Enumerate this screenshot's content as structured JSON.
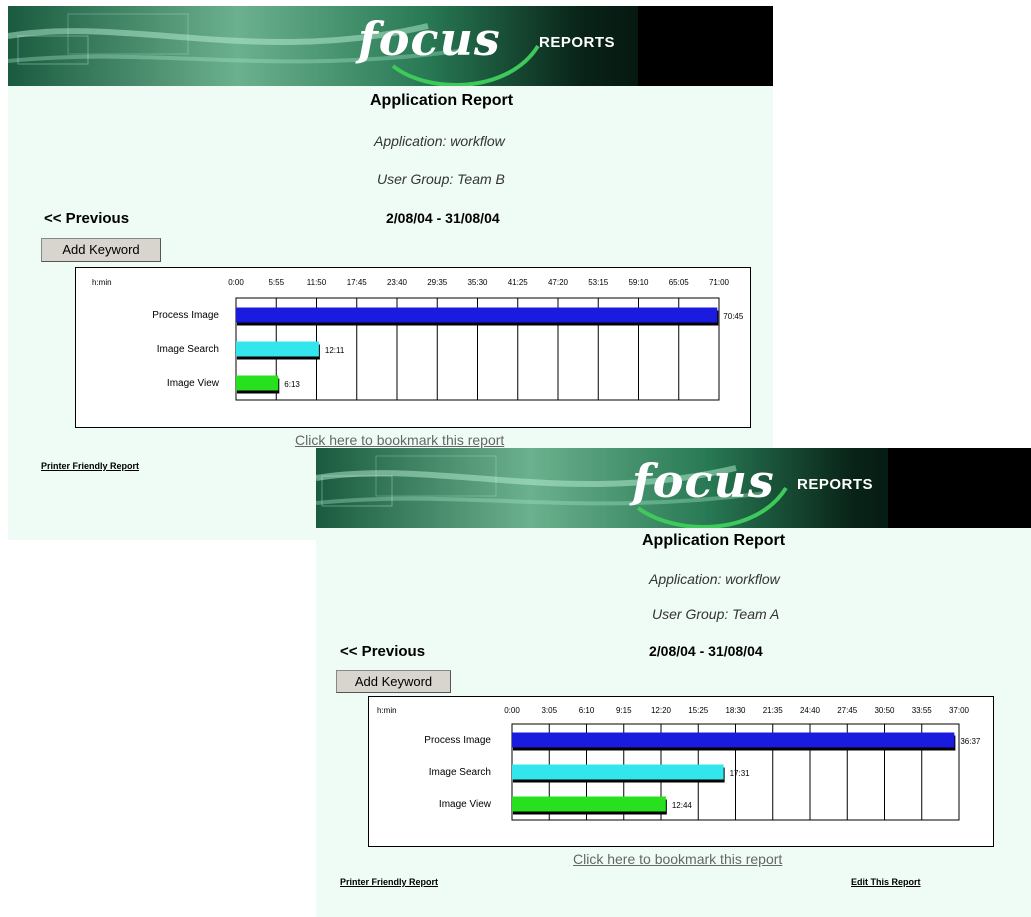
{
  "colors": {
    "background": "#effcf6",
    "bar_process": "#1b1be0",
    "bar_search": "#33e6ee",
    "bar_view": "#27e11f",
    "banner": "#000000"
  },
  "reports": [
    {
      "logo": "focus",
      "logo_sub": "REPORTS",
      "title": "Application Report",
      "application": "Application: workflow",
      "user_group": "User Group: Team B",
      "date_range": "2/08/04 - 31/08/04",
      "previous_label": "<< Previous",
      "add_keyword_label": "Add Keyword",
      "bookmark_label": "Click here to bookmark this report",
      "printer_friendly_label": "Printer Friendly Report",
      "chart_data": {
        "type": "bar",
        "orientation": "horizontal",
        "unit_label": "h:min",
        "x_ticks": [
          "0:00",
          "5:55",
          "11:50",
          "17:45",
          "23:40",
          "29:35",
          "35:30",
          "41:25",
          "47:20",
          "53:15",
          "59:10",
          "65:05",
          "71:00"
        ],
        "xlim_minutes": [
          0,
          4260
        ],
        "categories": [
          "Process Image",
          "Image Search",
          "Image View"
        ],
        "values_minutes": [
          4245,
          731,
          373
        ],
        "value_labels": [
          "70:45",
          "12:11",
          "6:13"
        ],
        "grid": true
      }
    },
    {
      "logo": "focus",
      "logo_sub": "REPORTS",
      "title": "Application Report",
      "application": "Application: workflow",
      "user_group": "User Group: Team A",
      "date_range": "2/08/04 - 31/08/04",
      "previous_label": "<< Previous",
      "add_keyword_label": "Add Keyword",
      "bookmark_label": "Click here to bookmark this report",
      "printer_friendly_label": "Printer Friendly Report",
      "edit_label": "Edit This Report",
      "chart_data": {
        "type": "bar",
        "orientation": "horizontal",
        "unit_label": "h:min",
        "x_ticks": [
          "0:00",
          "3:05",
          "6:10",
          "9:15",
          "12:20",
          "15:25",
          "18:30",
          "21:35",
          "24:40",
          "27:45",
          "30:50",
          "33:55",
          "37:00"
        ],
        "xlim_minutes": [
          0,
          2220
        ],
        "categories": [
          "Process Image",
          "Image Search",
          "Image View"
        ],
        "values_minutes": [
          2197,
          1051,
          764
        ],
        "value_labels": [
          "36:37",
          "17:31",
          "12:44"
        ],
        "grid": true
      }
    }
  ]
}
